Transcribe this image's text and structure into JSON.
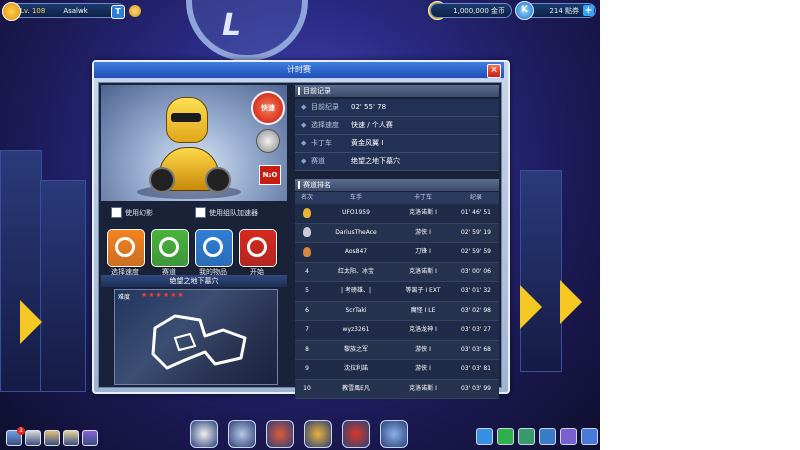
{
  "topbar": {
    "level": "Lv. 108",
    "username": "Asalwk",
    "t_button": "T",
    "coins": "1,000,000 金币",
    "k_icon": "K",
    "k_points": "214 點券",
    "plus": "+"
  },
  "dialog": {
    "title": "计时赛",
    "close": "×",
    "speed_badge": "快速",
    "nitro_badge": "N₂O",
    "checkbox_ghost": "使用幻影",
    "checkbox_boost": "使用组队加速器",
    "actions": [
      {
        "label": "选择速度",
        "color": "#f5821f",
        "icon": "speed-dial-icon"
      },
      {
        "label": "赛道",
        "color": "#49b33b",
        "icon": "track-icon"
      },
      {
        "label": "我的物品",
        "color": "#2f7fd6",
        "icon": "item-icon"
      },
      {
        "label": "开始",
        "color": "#d8281c",
        "icon": "start-icon"
      }
    ],
    "map_title": "绝望之地下墓穴",
    "map_difficulty_label": "难度",
    "map_stars": "★★★★★★",
    "record_section": "目前记录",
    "records": [
      {
        "key": "目前纪录",
        "value": "02' 55' 78"
      },
      {
        "key": "选择速度",
        "value": "快速 / 个人赛"
      },
      {
        "key": "卡丁车",
        "value": "黄金风翼 Ⅰ"
      },
      {
        "key": "赛道",
        "value": "绝望之地下墓穴"
      }
    ],
    "ranking_section": "赛道排名",
    "rank_headers": {
      "rank": "名次",
      "racer": "车手",
      "kart": "卡丁车",
      "record": "纪录"
    },
    "rankings": [
      {
        "rank": "",
        "medal": "#e9b530",
        "racer": "UFO1959",
        "kart": "克洛诺斯 Ⅰ",
        "record": "01' 46' 51"
      },
      {
        "rank": "",
        "medal": "#c8ccd8",
        "racer": "DariusTheAce",
        "kart": "游侠 Ⅰ",
        "record": "02' 59' 19"
      },
      {
        "rank": "",
        "medal": "#d48840",
        "racer": "Aos847",
        "kart": "刀锋 Ⅰ",
        "record": "02' 59' 59"
      },
      {
        "rank": "4",
        "medal": "",
        "racer": "红太阳、冰宝",
        "kart": "克洛诺斯 Ⅰ",
        "record": "03' 00' 06"
      },
      {
        "rank": "5",
        "medal": "",
        "racer": "| 考磅雄、|",
        "kart": "等离子 Ⅰ EXT",
        "record": "03' 01' 32"
      },
      {
        "rank": "6",
        "medal": "",
        "racer": "ScrTaki",
        "kart": "魔怪 Ⅰ LE",
        "record": "03' 02' 98"
      },
      {
        "rank": "7",
        "medal": "",
        "racer": "wyz3261",
        "kart": "克洛龙神 Ⅰ",
        "record": "03' 03' 27"
      },
      {
        "rank": "8",
        "medal": "",
        "racer": "黎族之军",
        "kart": "游侠 Ⅰ",
        "record": "03' 03' 68"
      },
      {
        "rank": "9",
        "medal": "",
        "racer": "沈拉利諾",
        "kart": "游侠 Ⅰ",
        "record": "03' 03' 81"
      },
      {
        "rank": "10",
        "medal": "",
        "racer": "教雪風E凡",
        "kart": "克洛诺斯 Ⅰ",
        "record": "03' 03' 99"
      }
    ]
  },
  "bottom_left": {
    "notification_count": "1",
    "icons": [
      "profile-icon",
      "home-icon",
      "shop-bag-icon",
      "notes-icon",
      "help-icon"
    ]
  },
  "bottom_center": {
    "icons": [
      "race-flag-icon",
      "speedometer-icon",
      "garage-icon",
      "store-icon",
      "toolbox-icon",
      "robot-icon"
    ]
  },
  "bottom_right": {
    "icons": [
      "alarm-icon",
      "exclamation-icon",
      "friends-icon",
      "screen-icon",
      "search-icon",
      "settings-icon"
    ]
  }
}
